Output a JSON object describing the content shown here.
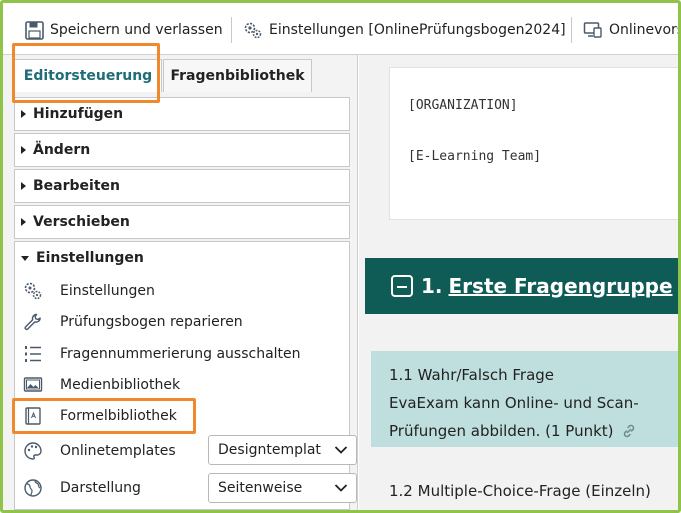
{
  "toolbar": {
    "save_label": "Speichern und verlassen",
    "settings_label": "Einstellungen [OnlinePrüfungsbogen2024]",
    "online_label": "Onlinevors"
  },
  "tabs": [
    {
      "label": "Editorsteuerung",
      "active": true
    },
    {
      "label": "Fragenbibliothek",
      "active": false
    }
  ],
  "sections": [
    {
      "label": "Hinzufügen",
      "expanded": false
    },
    {
      "label": "Ändern",
      "expanded": false
    },
    {
      "label": "Bearbeiten",
      "expanded": false
    },
    {
      "label": "Verschieben",
      "expanded": false
    },
    {
      "label": "Einstellungen",
      "expanded": true
    }
  ],
  "einstellungen_items": [
    {
      "label": "Einstellungen",
      "icon": "gears-icon"
    },
    {
      "label": "Prüfungsbogen reparieren",
      "icon": "wrench-icon"
    },
    {
      "label": "Fragennummerierung ausschalten",
      "icon": "numbered-list-icon"
    },
    {
      "label": "Medienbibliothek",
      "icon": "image-icon"
    },
    {
      "label": "Formelbibliothek",
      "icon": "book-icon"
    }
  ],
  "onlinetemplates": {
    "label": "Onlinetemplates",
    "value": "Designtemplat"
  },
  "darstellung": {
    "label": "Darstellung",
    "value": "Seitenweise"
  },
  "document": {
    "org": "[ORGANIZATION]",
    "team": "[E-Learning Team]",
    "group_number": "1.",
    "group_title": "Erste Fragengruppe",
    "q1_line1": "1.1 Wahr/Falsch Frage",
    "q1_line2": "EvaExam kann Online- und Scan-",
    "q1_line3": "Prüfungen abbilden. (1 Punkt)",
    "q2": "1.2 Multiple-Choice-Frage (Einzeln)"
  },
  "colors": {
    "accent_teal": "#0f5c57",
    "question_bg": "#bfdfde",
    "highlight_orange": "#f0882e",
    "frame_green": "#8fc34a"
  }
}
